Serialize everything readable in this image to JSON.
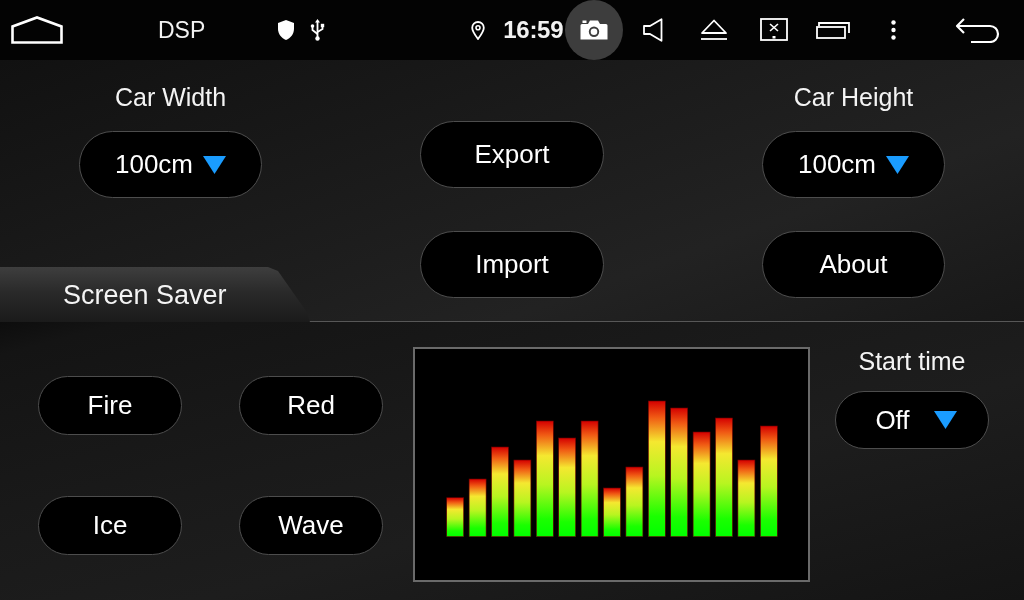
{
  "status_bar": {
    "title": "DSP",
    "time": "16:59",
    "camera_highlighted": true
  },
  "car_width": {
    "label": "Car Width",
    "value": "100cm"
  },
  "car_height": {
    "label": "Car Height",
    "value": "100cm"
  },
  "export_button": "Export",
  "import_button": "Import",
  "about_button": "About",
  "screen_saver": {
    "title": "Screen Saver",
    "styles": [
      "Fire",
      "Red",
      "Ice",
      "Wave"
    ],
    "start_time": {
      "label": "Start time",
      "value": "Off"
    }
  }
}
